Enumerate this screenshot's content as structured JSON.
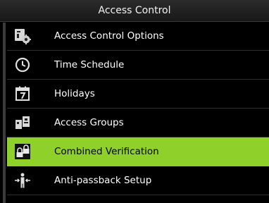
{
  "header": {
    "title": "Access Control"
  },
  "menu": {
    "items": [
      {
        "label": "Access Control Options",
        "icon": "settings-gear-icon"
      },
      {
        "label": "Time Schedule",
        "icon": "clock-icon"
      },
      {
        "label": "Holidays",
        "icon": "calendar-icon"
      },
      {
        "label": "Access Groups",
        "icon": "group-icon"
      },
      {
        "label": "Combined Verification",
        "icon": "lock-pair-icon",
        "selected": true
      },
      {
        "label": "Anti-passback Setup",
        "icon": "person-arrows-icon"
      }
    ]
  },
  "colors": {
    "selected_background": "#8fd12a",
    "background": "#000000",
    "text": "#ffffff"
  }
}
